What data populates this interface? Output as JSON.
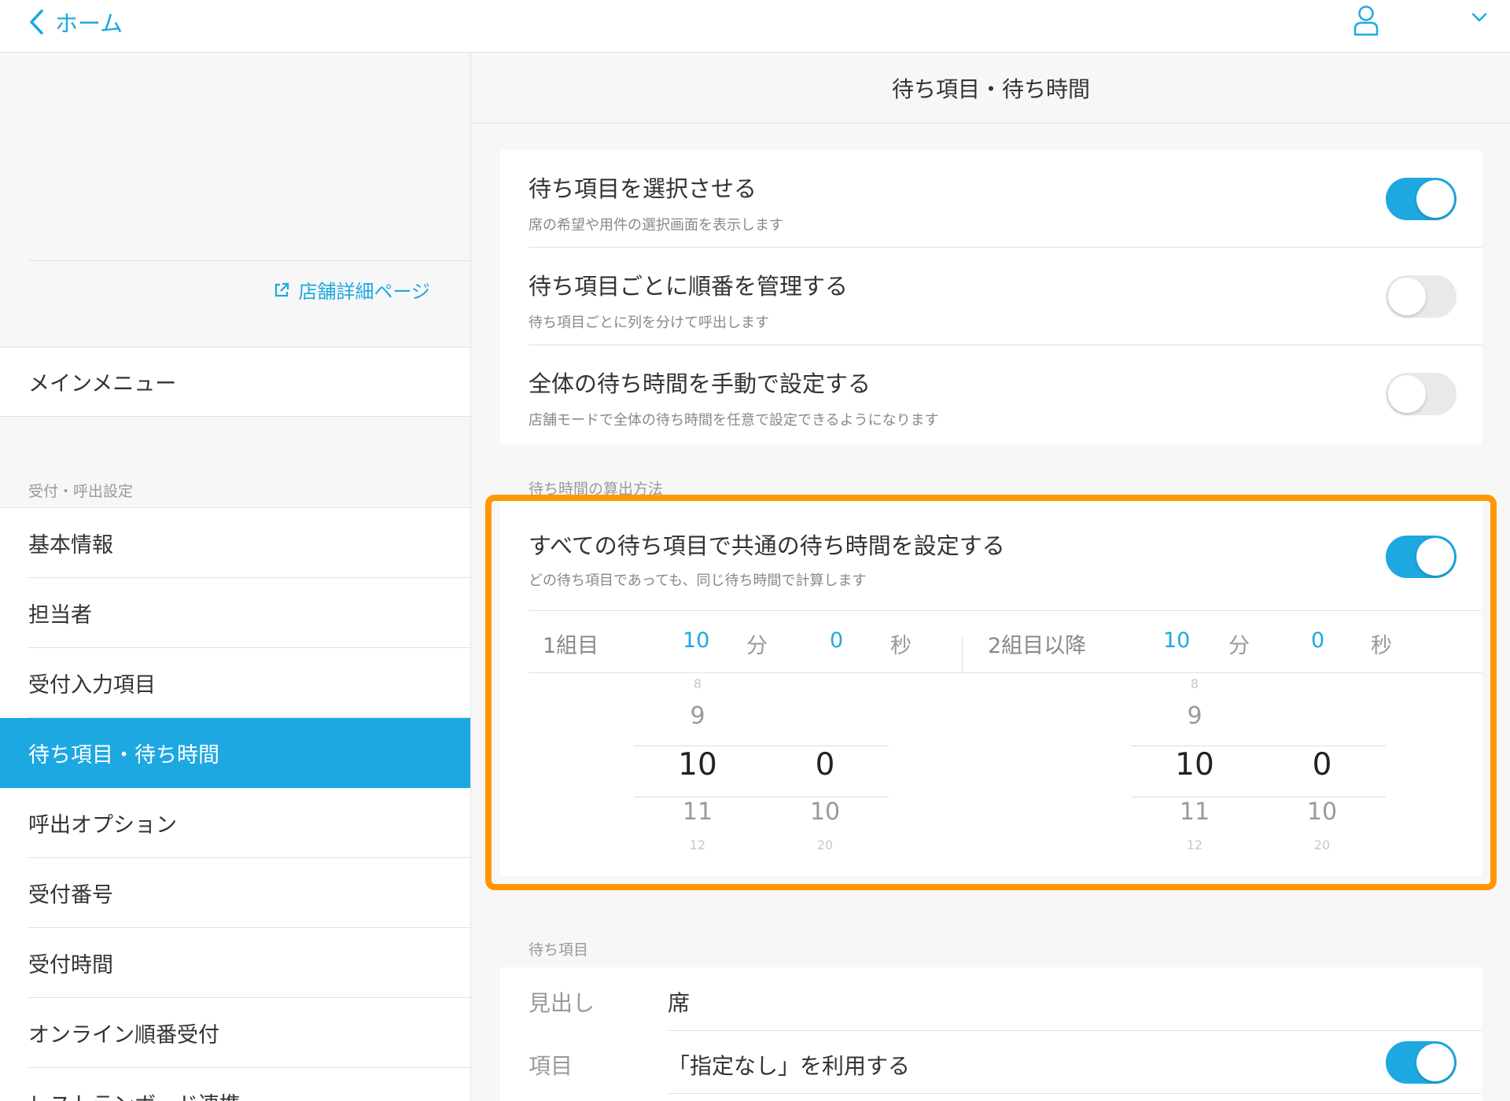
{
  "topbar": {
    "back_label": "ホーム"
  },
  "sidebar": {
    "shop_link": "店舗詳細ページ",
    "main_menu": "メインメニュー",
    "section_label": "受付・呼出設定",
    "items": [
      {
        "label": "基本情報"
      },
      {
        "label": "担当者"
      },
      {
        "label": "受付入力項目"
      },
      {
        "label": "待ち項目・待ち時間",
        "active": true
      },
      {
        "label": "呼出オプション"
      },
      {
        "label": "受付番号"
      },
      {
        "label": "受付時間"
      },
      {
        "label": "オンライン順番受付"
      },
      {
        "label": "レストランボード連携"
      }
    ]
  },
  "main": {
    "title": "待ち項目・待ち時間",
    "settings": [
      {
        "title": "待ち項目を選択させる",
        "subtitle": "席の希望や用件の選択画面を表示します",
        "enabled": true
      },
      {
        "title": "待ち項目ごとに順番を管理する",
        "subtitle": "待ち項目ごとに列を分けて呼出します",
        "enabled": false
      },
      {
        "title": "全体の待ち時間を手動で設定する",
        "subtitle": "店舗モードで全体の待ち時間を任意で設定できるようになります",
        "enabled": false
      }
    ],
    "calc_section": {
      "label": "待ち時間の算出方法",
      "title": "すべての待ち項目で共通の待ち時間を設定する",
      "subtitle": "どの待ち項目であっても、同じ待ち時間で計算します",
      "enabled": true,
      "first": {
        "label": "1組目",
        "minutes": "10",
        "min_unit": "分",
        "seconds": "0",
        "sec_unit": "秒"
      },
      "later": {
        "label": "2組目以降",
        "minutes": "10",
        "min_unit": "分",
        "seconds": "0",
        "sec_unit": "秒"
      },
      "picker": {
        "min_far_above": "8",
        "min_above": "9",
        "min_selected": "10",
        "min_below": "11",
        "min_far_below": "12",
        "sec_selected": "0",
        "sec_below": "10",
        "sec_far_below": "20"
      }
    },
    "items_section": {
      "label": "待ち項目",
      "heading_label": "見出し",
      "heading_value": "席",
      "item_label": "項目",
      "item_value": "「指定なし」を利用する",
      "item_enabled": true
    }
  },
  "colors": {
    "accent": "#1da8e2",
    "highlight": "#ff9800"
  }
}
